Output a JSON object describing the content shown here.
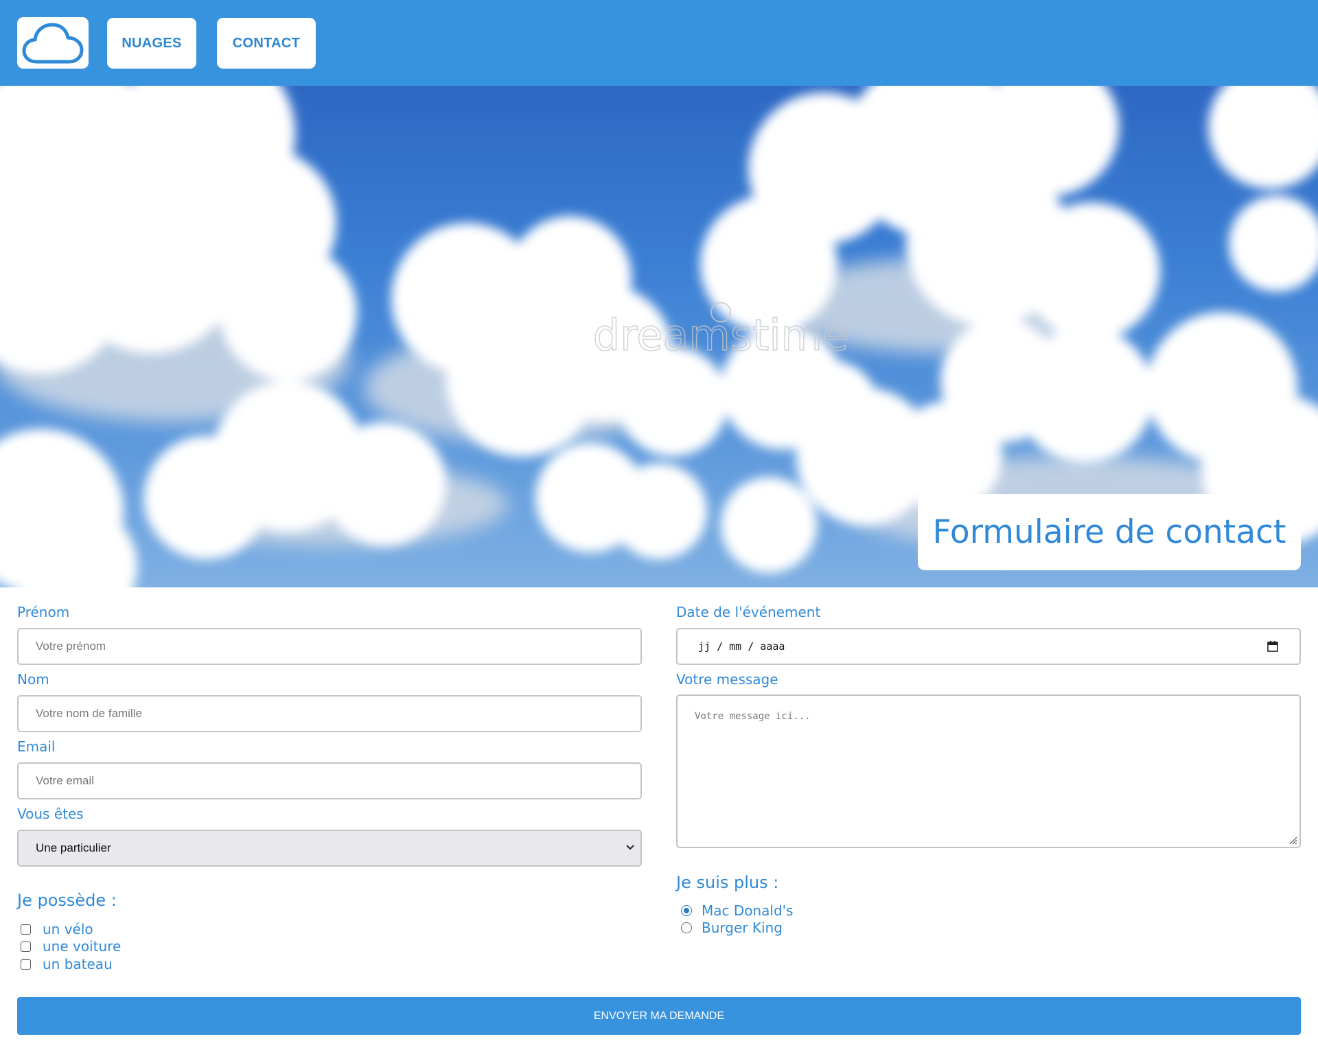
{
  "header": {
    "logo_icon": "cloud-icon",
    "nav": [
      {
        "label": "NUAGES"
      },
      {
        "label": "CONTACT"
      }
    ],
    "background_color": "#3893de"
  },
  "hero": {
    "title": "Formulaire de contact",
    "watermark": "dreamstime"
  },
  "form": {
    "prenom": {
      "label": "Prénom",
      "placeholder": "Votre prénom"
    },
    "nom": {
      "label": "Nom",
      "placeholder": "Votre nom de famille"
    },
    "email": {
      "label": "Email",
      "placeholder": "Votre email"
    },
    "vous_etes": {
      "label": "Vous êtes",
      "selected": "Une particulier"
    },
    "date": {
      "label": "Date de l'événement",
      "value": "jj / mm / aaaa",
      "icon": "calendar-icon"
    },
    "message": {
      "label": "Votre message",
      "placeholder": "Votre message ici..."
    },
    "possede": {
      "heading": "Je possède :",
      "options": [
        {
          "label": "un vélo",
          "checked": false
        },
        {
          "label": "une voiture",
          "checked": false
        },
        {
          "label": "un bateau",
          "checked": false
        }
      ]
    },
    "suis_plus": {
      "heading": "Je suis plus :",
      "options": [
        {
          "label": "Mac Donald's",
          "selected": true
        },
        {
          "label": "Burger King",
          "selected": false
        }
      ]
    },
    "submit_label": "ENVOYER MA DEMANDE"
  },
  "colors": {
    "accent": "#3893de",
    "label_text": "#3089d8"
  }
}
